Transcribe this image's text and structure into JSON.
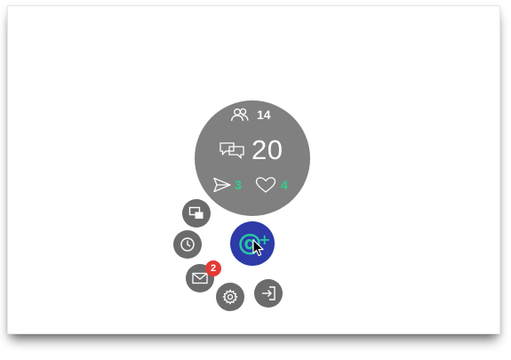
{
  "stats": {
    "contacts_count": "14",
    "messages_count": "20",
    "sent_count": "3",
    "likes_count": "4"
  },
  "menu": {
    "inbox_badge": "2",
    "main_icon": "at-plus-icon",
    "items": [
      "screens-icon",
      "history-icon",
      "inbox-icon",
      "settings-icon",
      "logout-icon"
    ]
  },
  "colors": {
    "stats_bg": "#808080",
    "button_bg": "#6b6b6b",
    "main_bg": "#2d3aa8",
    "accent": "#27c6a3",
    "green": "#2fd08a",
    "badge": "#e53935"
  }
}
